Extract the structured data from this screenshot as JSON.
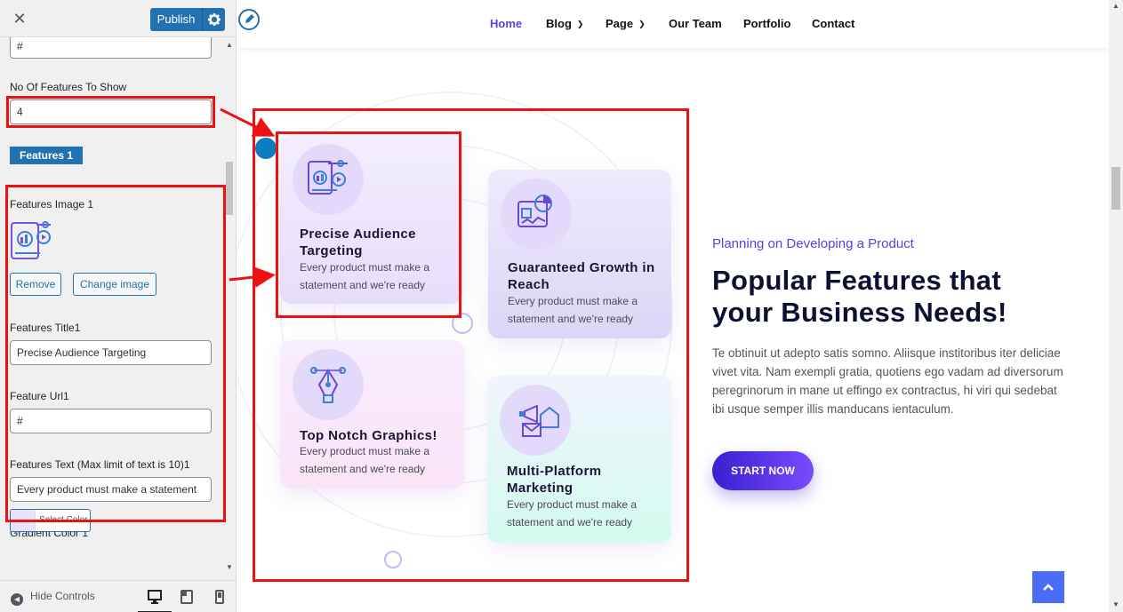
{
  "customizer": {
    "header": {
      "close_icon": "close-icon",
      "publish_label": "Publish",
      "gear_icon": "gear-icon"
    },
    "top_url_value": "#",
    "no_of_features_label": "No Of Features To Show",
    "no_of_features_value": "4",
    "section_badge": "Features 1",
    "features_image_label": "Features Image 1",
    "remove_label": "Remove",
    "change_image_label": "Change image",
    "features_title_label": "Features Title1",
    "features_title_value": "Precise Audience Targeting",
    "feature_url_label": "Feature Url1",
    "feature_url_value": "#",
    "features_text_label": "Features Text (Max limit of text is 10)1",
    "features_text_value": "Every product must make a statement",
    "gradient_color_label": "Gradient Color 1",
    "select_color_label": "Select Color",
    "swatch_color": "#e8e2fb",
    "footer": {
      "hide_controls_label": "Hide Controls",
      "devices": [
        "desktop-icon",
        "tablet-icon",
        "mobile-icon"
      ]
    }
  },
  "preview": {
    "nav": [
      {
        "label": "Home",
        "active": true,
        "dropdown": false
      },
      {
        "label": "Blog",
        "active": false,
        "dropdown": true
      },
      {
        "label": "Page",
        "active": false,
        "dropdown": true
      },
      {
        "label": "Our Team",
        "active": false,
        "dropdown": false
      },
      {
        "label": "Portfolio",
        "active": false,
        "dropdown": false
      },
      {
        "label": "Contact",
        "active": false,
        "dropdown": false
      }
    ],
    "cards": [
      {
        "title": "Precise Audience Targeting",
        "text": "Every product must make a statement and we're ready",
        "icon": "analytics-icon"
      },
      {
        "title": "Guaranteed Growth in Reach",
        "text": "Every product must make a statement and we're ready",
        "icon": "growth-chart-icon"
      },
      {
        "title": "Top Notch Graphics!",
        "text": "Every product must make a statement and we're ready",
        "icon": "pen-tool-icon"
      },
      {
        "title": "Multi-Platform Marketing",
        "text": "Every product must make a statement and we're ready",
        "icon": "megaphone-icon"
      }
    ],
    "eyebrow": "Planning on Developing a Product",
    "headline": "Popular Features that your Business Needs!",
    "paragraph": "Te obtinuit ut adepto satis somno. Aliisque institoribus iter deliciae vivet vita. Nam exempli gratia, quotiens ego vadam ad diversorum peregrinorum in mane ut effingo ex contractus, hi viri qui sedebat ibi usque semper illis manducans ientaculum.",
    "cta_label": "START NOW",
    "colors": {
      "accent": "#5b3fe4",
      "wp_blue": "#2271b1",
      "annotation_red": "#ee1111"
    }
  }
}
